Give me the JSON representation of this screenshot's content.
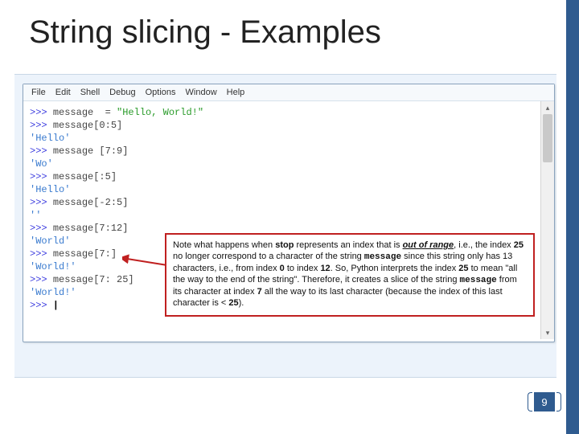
{
  "title": "String slicing - Examples",
  "menu": {
    "items": [
      "File",
      "Edit",
      "Shell",
      "Debug",
      "Options",
      "Window",
      "Help"
    ]
  },
  "code_lines": [
    {
      "type": "in",
      "raw": "message  = \"Hello, World!\""
    },
    {
      "type": "in",
      "raw": "message[0:5]"
    },
    {
      "type": "out",
      "raw": "'Hello'"
    },
    {
      "type": "in",
      "raw": "message [7:9]"
    },
    {
      "type": "out",
      "raw": "'Wo'"
    },
    {
      "type": "in",
      "raw": "message[:5]"
    },
    {
      "type": "out",
      "raw": "'Hello'"
    },
    {
      "type": "in",
      "raw": "message[-2:5]"
    },
    {
      "type": "out",
      "raw": "''"
    },
    {
      "type": "in",
      "raw": "message[7:12]"
    },
    {
      "type": "out",
      "raw": "'World'"
    },
    {
      "type": "in",
      "raw": "message[7:]"
    },
    {
      "type": "out",
      "raw": "'World!'"
    },
    {
      "type": "in",
      "raw": "message[7: 25]"
    },
    {
      "type": "out",
      "raw": "'World!'"
    },
    {
      "type": "cursor",
      "raw": ""
    }
  ],
  "note": {
    "t1": "Note what happens when ",
    "stop": "stop",
    "t2": " represents an index that is ",
    "oor": "out of range",
    "t3": ", i.e., the index ",
    "n25a": "25",
    "t4": " no longer correspond to a character of the string ",
    "msg1": "message",
    "t5": " since this string only has 13 characters, i.e., from index ",
    "n0": "0",
    "t6": " to index ",
    "n12": "12",
    "t7": ". So, Python interprets the index ",
    "n25b": "25",
    "t8": " to mean \"all the way to the end of the string\". Therefore, it creates a slice of the string ",
    "msg2": "message",
    "t9": " from its character at index ",
    "n7": "7",
    "t10": " all the way to its last character (because the index of this last character is < ",
    "n25c": "25",
    "t11": ")."
  },
  "page_number": "9",
  "scroll": {
    "up": "▴",
    "down": "▾"
  }
}
